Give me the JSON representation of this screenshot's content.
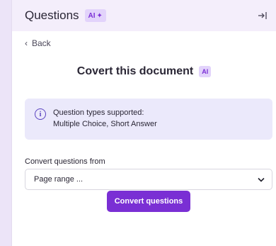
{
  "header": {
    "title": "Questions",
    "ai_badge": "AI",
    "ai_sparkle": "✦"
  },
  "nav": {
    "back_label": "Back"
  },
  "main": {
    "heading": "Covert this document",
    "heading_badge": "AI",
    "info": {
      "line1": "Question types supported:",
      "line2": "Multiple Choice, Short Answer"
    },
    "convert_from_label": "Convert questions from",
    "select_value": "Page range ...",
    "convert_button_label": "Convert questions"
  },
  "icons": {
    "collapse": "collapse-panel-icon",
    "back": "chevron-left-icon",
    "info": "info-icon",
    "select": "chevron-down-icon"
  },
  "colors": {
    "accent": "#7a2fd4",
    "header_bg": "#f4eefb",
    "info_bg": "#ebe9fb",
    "badge_bg": "#e2d3fb"
  }
}
